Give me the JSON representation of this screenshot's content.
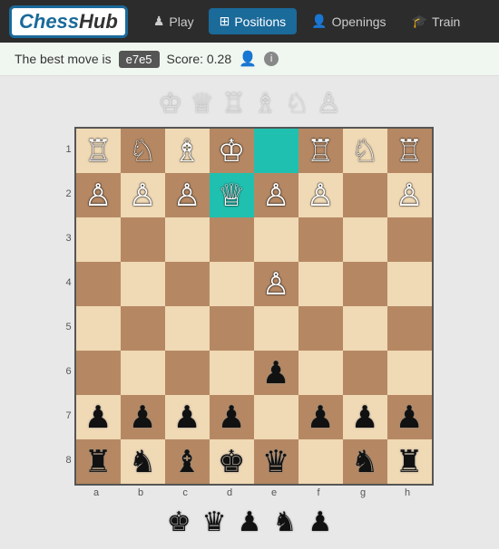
{
  "header": {
    "logo_text": "ChessHub",
    "nav_items": [
      {
        "label": "Play",
        "icon": "♟",
        "active": false
      },
      {
        "label": "Positions",
        "icon": "⊞",
        "active": true
      },
      {
        "label": "Openings",
        "icon": "👤",
        "active": false
      },
      {
        "label": "Train",
        "icon": "🎓",
        "active": false
      }
    ]
  },
  "best_move_bar": {
    "prefix": "The best move is",
    "move": "e7e5",
    "score_label": "Score: 0.28",
    "info": "i"
  },
  "board": {
    "ranks": [
      "1",
      "2",
      "3",
      "4",
      "5",
      "6",
      "7",
      "8"
    ],
    "files": [
      "a",
      "b",
      "c",
      "d",
      "e",
      "f",
      "g",
      "h"
    ]
  },
  "top_tray_pieces": [
    "♔",
    "♕",
    "♖",
    "♗",
    "♘",
    "♙"
  ],
  "bottom_tray_pieces": [
    "♚",
    "♛",
    "♟",
    "♞",
    "♟"
  ]
}
